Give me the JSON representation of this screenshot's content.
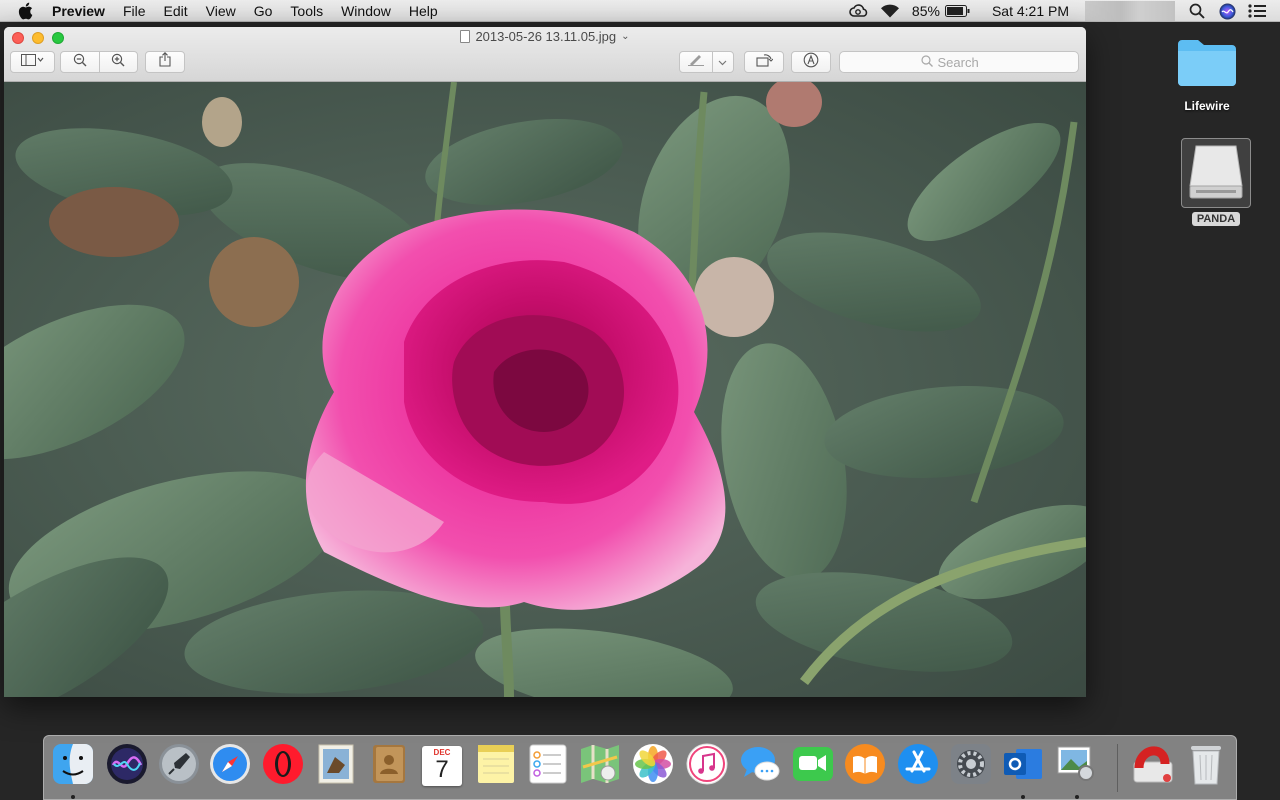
{
  "menubar": {
    "app_name": "Preview",
    "menus": [
      "File",
      "Edit",
      "View",
      "Go",
      "Tools",
      "Window",
      "Help"
    ],
    "battery_percent": "85%",
    "clock": "Sat 4:21 PM"
  },
  "window": {
    "title": "2013-05-26 13.11.05.jpg",
    "search_placeholder": "Search",
    "photo_subject": "pink-rose-photo"
  },
  "desktop": {
    "folder_label": "Lifewire",
    "drive_label": "PANDA"
  },
  "dock": {
    "apps": [
      "Finder",
      "Siri",
      "Launchpad",
      "Safari",
      "Opera",
      "Mail",
      "Contacts",
      "Calendar",
      "Notes",
      "Reminders",
      "Maps",
      "Photos",
      "iTunes",
      "Messages",
      "FaceTime",
      "iBooks",
      "App Store",
      "System Preferences",
      "Outlook",
      "Preview",
      "Downloads",
      "Trash"
    ],
    "calendar_month": "DEC",
    "calendar_day": "7"
  },
  "colors": {
    "close": "#fc5f57",
    "minimize": "#fdbc2e",
    "maximize": "#28c840",
    "rose": "#d81a8a",
    "leaf": "#5e7a62"
  }
}
